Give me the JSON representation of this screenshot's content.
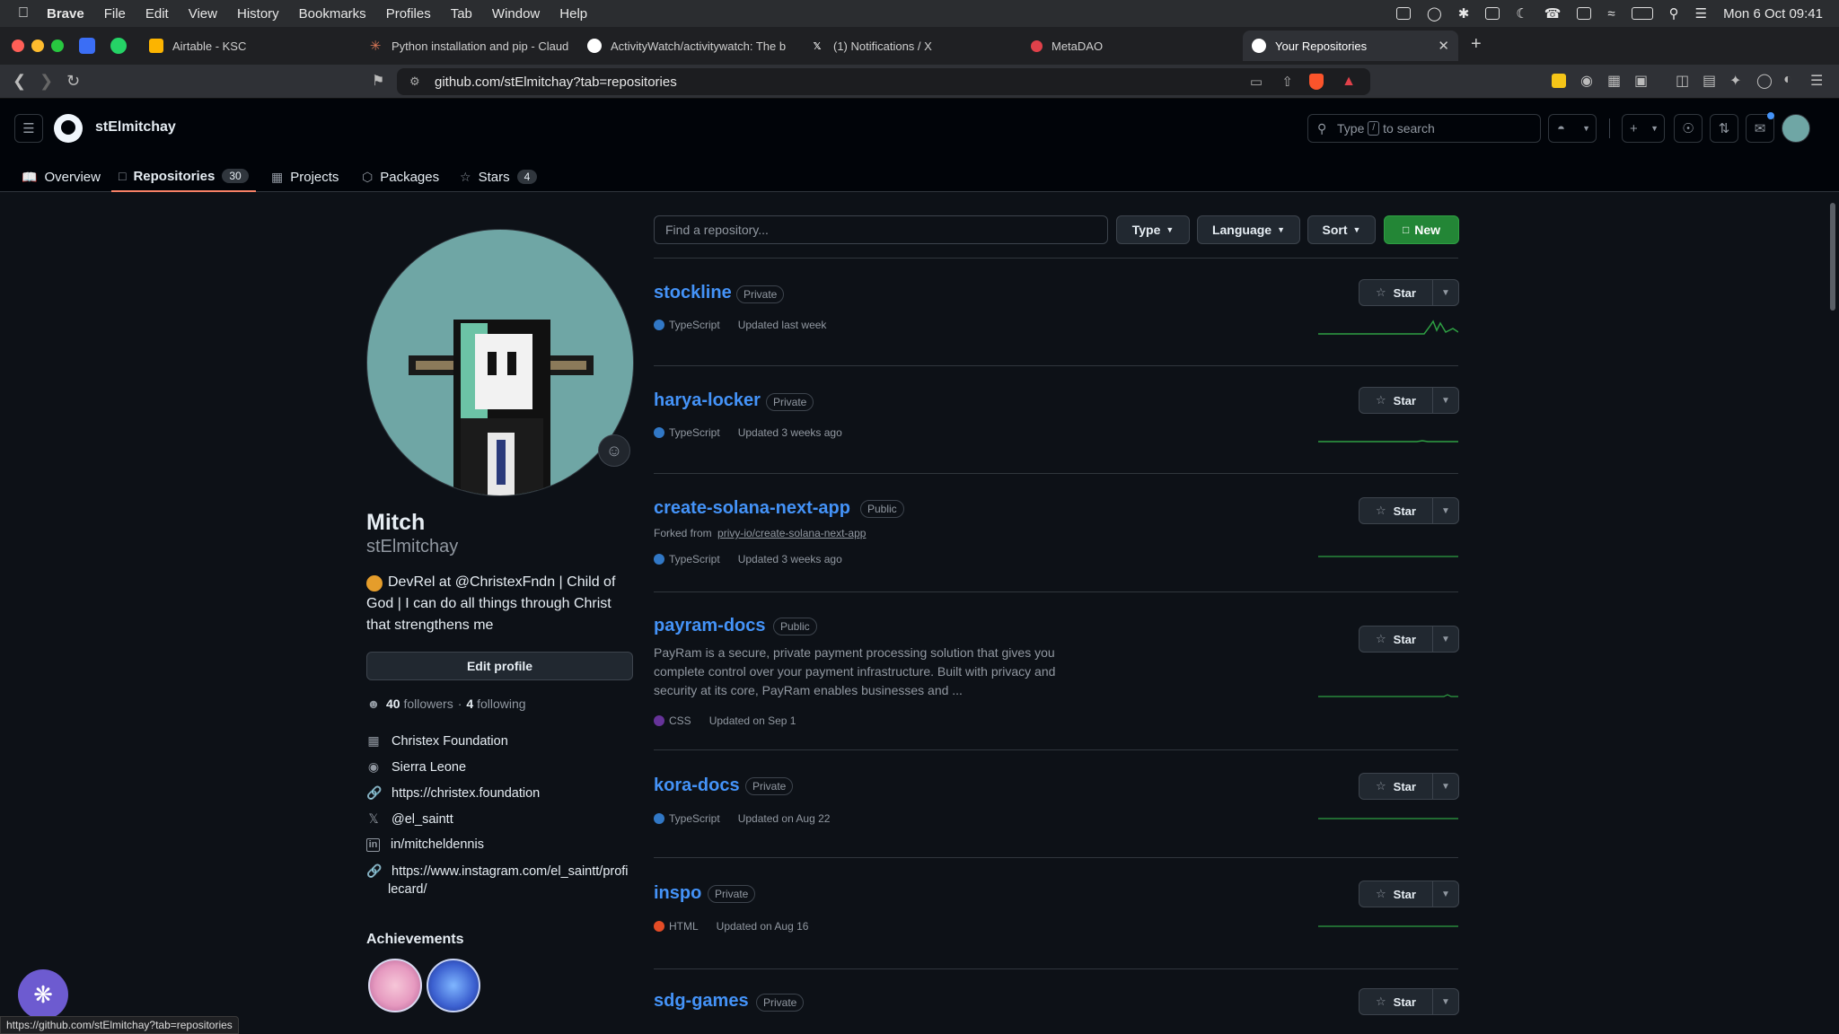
{
  "menubar": {
    "app": "Brave",
    "items": [
      "File",
      "Edit",
      "View",
      "History",
      "Bookmarks",
      "Profiles",
      "Tab",
      "Window",
      "Help"
    ],
    "clock": "Mon 6 Oct  09:41"
  },
  "tabs": [
    {
      "title": "Airtable - KSC",
      "icon": "airtable-icon"
    },
    {
      "title": "Python installation and pip - Claud",
      "icon": "claude-icon"
    },
    {
      "title": "ActivityWatch/activitywatch: The b",
      "icon": "github-icon"
    },
    {
      "title": "(1) Notifications / X",
      "icon": "x-icon"
    },
    {
      "title": "MetaDAO",
      "icon": "metadao-icon"
    },
    {
      "title": "Your Repositories",
      "icon": "github-icon"
    }
  ],
  "address": {
    "url": "github.com/stElmitchay?tab=repositories"
  },
  "header": {
    "username": "stElmitchay",
    "search_pre": "Type",
    "search_key": "/",
    "search_post": "to search"
  },
  "profile_nav": [
    {
      "label": "Overview",
      "icon": "book-icon"
    },
    {
      "label": "Repositories",
      "count": "30",
      "icon": "repo-icon"
    },
    {
      "label": "Projects",
      "icon": "table-icon"
    },
    {
      "label": "Packages",
      "icon": "package-icon"
    },
    {
      "label": "Stars",
      "count": "4",
      "icon": "star-icon"
    }
  ],
  "profile": {
    "name": "Mitch",
    "login": "stElmitchay",
    "bio_line1": "DevRel at @ChristexFndn | Child of",
    "bio_line2": "God | I can do all things through Christ",
    "bio_line3": "that strengthens me",
    "edit_label": "Edit profile",
    "followers": "40",
    "followers_label": "followers",
    "following": "4",
    "following_label": "following",
    "company": "Christex Foundation",
    "location": "Sierra Leone",
    "website": "https://christex.foundation",
    "x_handle": "@el_saintt",
    "linkedin": "in/mitcheldennis",
    "instagram_line1": "https://www.instagram.com/el_saintt/profi",
    "instagram_line2": "lecard/",
    "achievements_title": "Achievements"
  },
  "filters": {
    "find_placeholder": "Find a repository...",
    "type": "Type",
    "language": "Language",
    "sort": "Sort",
    "new": "New"
  },
  "repos": [
    {
      "name": "stockline",
      "visibility": "Private",
      "language": "TypeScript",
      "lang_color": "#3178c6",
      "updated": "Updated last week"
    },
    {
      "name": "harya-locker",
      "visibility": "Private",
      "language": "TypeScript",
      "lang_color": "#3178c6",
      "updated": "Updated 3 weeks ago"
    },
    {
      "name": "create-solana-next-app",
      "visibility": "Public",
      "forked_prefix": "Forked from",
      "forked_from": "privy-io/create-solana-next-app",
      "language": "TypeScript",
      "lang_color": "#3178c6",
      "updated": "Updated 3 weeks ago"
    },
    {
      "name": "payram-docs",
      "visibility": "Public",
      "desc_line1": "PayRam is a secure, private payment processing solution that gives you",
      "desc_line2": "complete control over your payment infrastructure. Built with privacy and",
      "desc_line3": "security at its core, PayRam enables businesses and ...",
      "language": "CSS",
      "lang_color": "#663399",
      "updated": "Updated on Sep 1"
    },
    {
      "name": "kora-docs",
      "visibility": "Private",
      "language": "TypeScript",
      "lang_color": "#3178c6",
      "updated": "Updated on Aug 22"
    },
    {
      "name": "inspo",
      "visibility": "Private",
      "language": "HTML",
      "lang_color": "#e34c26",
      "updated": "Updated on Aug 16"
    },
    {
      "name": "sdg-games",
      "visibility": "Private"
    }
  ],
  "star_label": "Star",
  "status_url": "https://github.com/stElmitchay?tab=repositories"
}
